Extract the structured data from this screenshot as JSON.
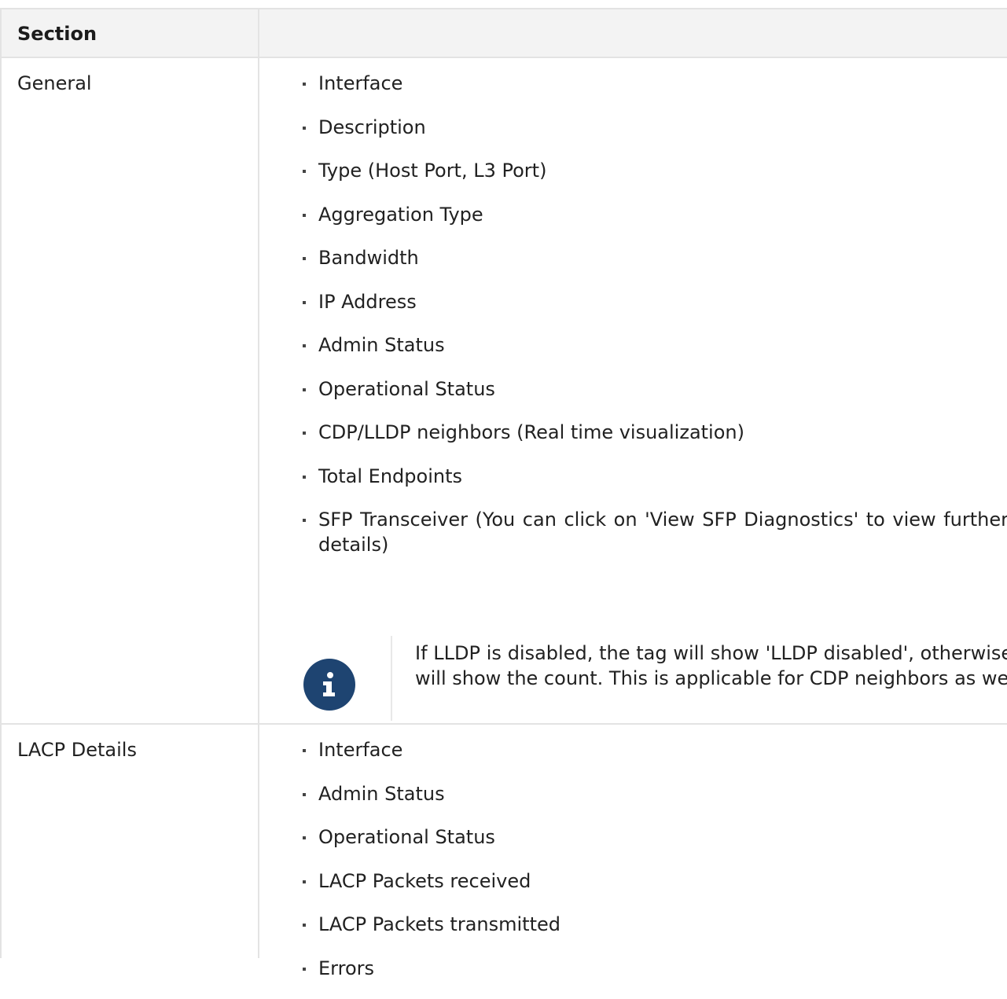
{
  "table": {
    "header": {
      "section": "Section",
      "details": ""
    },
    "rows": [
      {
        "section": "General",
        "items": [
          "Interface",
          "Description",
          "Type (Host Port, L3 Port)",
          "Aggregation Type",
          "Bandwidth",
          "IP Address",
          "Admin Status",
          "Operational Status",
          "CDP/LLDP neighbors (Real time visualization)",
          "Total Endpoints",
          "SFP Transceiver (You can click on 'View SFP Diagnostics' to view further details)"
        ],
        "note": {
          "icon": "info-icon",
          "text": "If LLDP is disabled, the tag will show 'LLDP disabled', otherwise it will show the count. This is applicable for CDP neighbors as well."
        }
      },
      {
        "section": "LACP Details",
        "items": [
          "Interface",
          "Admin Status",
          "Operational Status",
          "LACP Packets received",
          "LACP Packets transmitted",
          "Errors"
        ]
      }
    ]
  },
  "colors": {
    "note_icon_bg": "#1e4471",
    "border": "#e3e3e3",
    "header_bg": "#f3f3f3"
  }
}
